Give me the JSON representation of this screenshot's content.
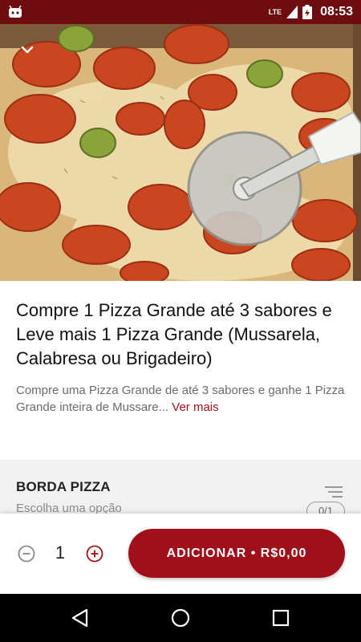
{
  "status_bar": {
    "network": "LTE",
    "time": "08:53"
  },
  "product": {
    "title": "Compre 1 Pizza  Grande até 3 sabores e Leve mais 1 Pizza Grande (Mussarela, Calabresa ou Brigadeiro)",
    "description": "Compre uma Pizza Grande de até 3 sabores e ganhe 1 Pizza Grande inteira de Mussare...",
    "see_more_label": "Ver mais"
  },
  "option_section": {
    "title": "BORDA PIZZA",
    "subtitle": "Escolha uma opção",
    "selection_count": "0/1"
  },
  "cart": {
    "quantity": "1",
    "add_button_label": "ADICIONAR • R$0,00"
  },
  "colors": {
    "primary": "#a0101a",
    "status_bar": "#6d0d10"
  },
  "icons": {
    "app": "android-icon",
    "back": "chevron-down-icon",
    "minus": "minus-circle-icon",
    "plus": "plus-circle-icon",
    "section": "sort-lines-icon",
    "nav_back": "nav-back-icon",
    "nav_home": "nav-home-icon",
    "nav_recents": "nav-recents-icon"
  }
}
